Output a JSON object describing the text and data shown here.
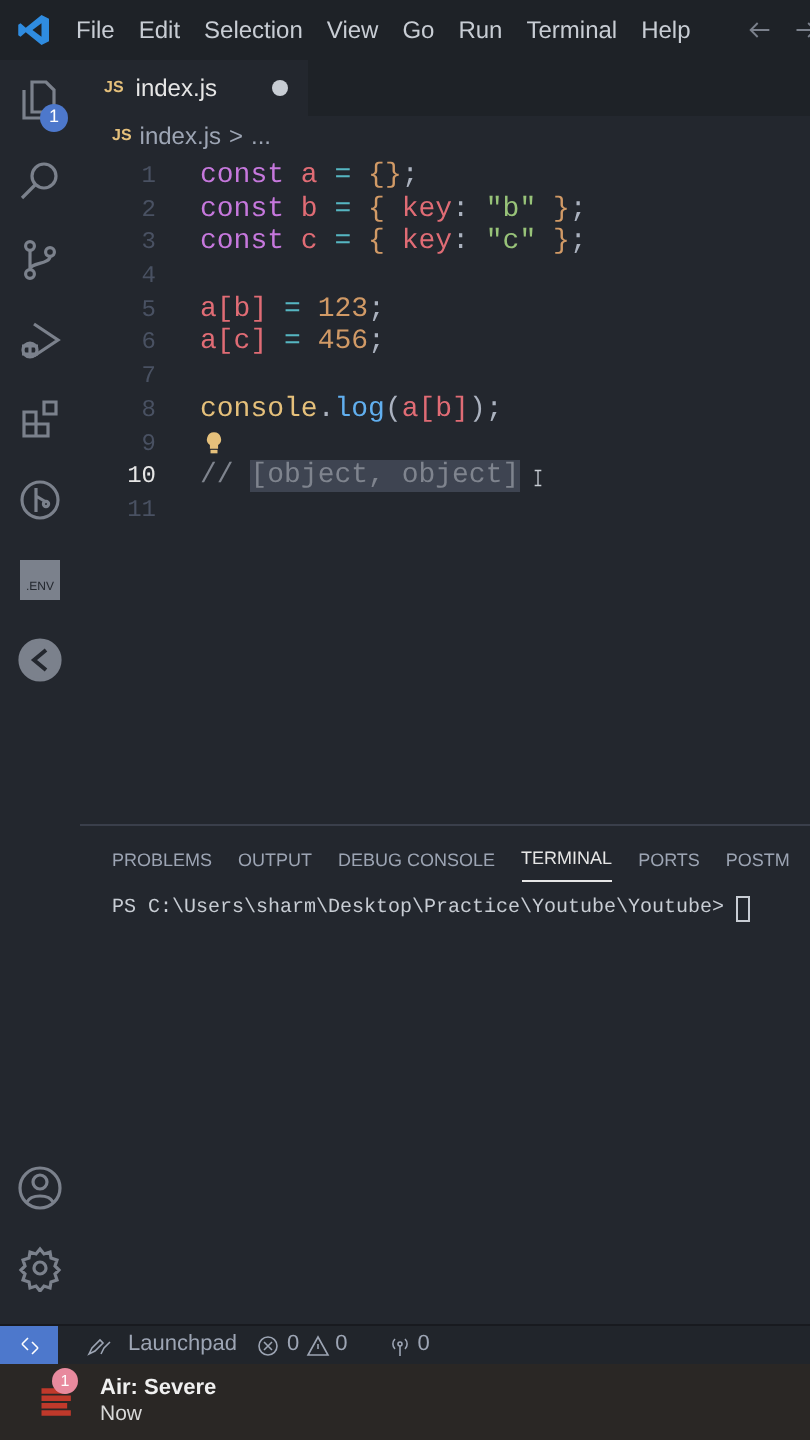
{
  "menu": [
    "File",
    "Edit",
    "Selection",
    "View",
    "Go",
    "Run",
    "Terminal",
    "Help"
  ],
  "activity_bar": {
    "top": [
      {
        "kind": "explorer",
        "badge": "1",
        "selected": false
      },
      {
        "kind": "search",
        "selected": false
      },
      {
        "kind": "source-control",
        "selected": false
      },
      {
        "kind": "run-debug",
        "selected": false
      },
      {
        "kind": "extensions",
        "selected": false
      },
      {
        "kind": "git-graph",
        "selected": false
      },
      {
        "kind": "env",
        "label": ".ENV",
        "selected": false
      },
      {
        "kind": "remote",
        "selected": false
      }
    ],
    "bottom": [
      {
        "kind": "account"
      },
      {
        "kind": "settings"
      }
    ]
  },
  "tabs": [
    {
      "badge": "JS",
      "label": "index.js",
      "modified": true,
      "selected": true
    }
  ],
  "breadcrumb": {
    "badge": "JS",
    "file": "index.js",
    "separator": ">",
    "rest": "..."
  },
  "editor": {
    "lines": [
      {
        "number": "1",
        "active": false,
        "lightbulb": false,
        "tokens": [
          {
            "text": "const",
            "kind": "keyword"
          },
          {
            "text": " a ",
            "kind": "var"
          },
          {
            "text": "=",
            "kind": "op"
          },
          {
            "text": " {}",
            "kind": "brace"
          },
          {
            "text": ";",
            "kind": "punct"
          }
        ]
      },
      {
        "number": "2",
        "active": false,
        "lightbulb": false,
        "tokens": [
          {
            "text": "const",
            "kind": "keyword"
          },
          {
            "text": " b ",
            "kind": "var"
          },
          {
            "text": "=",
            "kind": "op"
          },
          {
            "text": " { ",
            "kind": "brace"
          },
          {
            "text": "key",
            "kind": "prop"
          },
          {
            "text": ": ",
            "kind": "punct"
          },
          {
            "text": "\"b\"",
            "kind": "string"
          },
          {
            "text": " }",
            "kind": "brace"
          },
          {
            "text": ";",
            "kind": "punct"
          }
        ]
      },
      {
        "number": "3",
        "active": false,
        "lightbulb": false,
        "tokens": [
          {
            "text": "const",
            "kind": "keyword"
          },
          {
            "text": " c ",
            "kind": "var"
          },
          {
            "text": "=",
            "kind": "op"
          },
          {
            "text": " { ",
            "kind": "brace"
          },
          {
            "text": "key",
            "kind": "prop"
          },
          {
            "text": ": ",
            "kind": "punct"
          },
          {
            "text": "\"c\"",
            "kind": "string"
          },
          {
            "text": " }",
            "kind": "brace"
          },
          {
            "text": ";",
            "kind": "punct"
          }
        ]
      },
      {
        "number": "4",
        "active": false,
        "lightbulb": false
      },
      {
        "number": "5",
        "active": false,
        "lightbulb": false,
        "tokens": [
          {
            "text": "a[b]",
            "kind": "var"
          },
          {
            "text": " = ",
            "kind": "op"
          },
          {
            "text": "123",
            "kind": "number"
          },
          {
            "text": ";",
            "kind": "punct"
          }
        ]
      },
      {
        "number": "6",
        "active": false,
        "lightbulb": false,
        "tokens": [
          {
            "text": "a[c]",
            "kind": "var"
          },
          {
            "text": " = ",
            "kind": "op"
          },
          {
            "text": "456",
            "kind": "number"
          },
          {
            "text": ";",
            "kind": "punct"
          }
        ]
      },
      {
        "number": "7",
        "active": false,
        "lightbulb": false
      },
      {
        "number": "8",
        "active": false,
        "lightbulb": false,
        "tokens": [
          {
            "text": "console",
            "kind": "object"
          },
          {
            "text": ".",
            "kind": "punct"
          },
          {
            "text": "log",
            "kind": "function"
          },
          {
            "text": "(",
            "kind": "punct"
          },
          {
            "text": "a[b]",
            "kind": "var"
          },
          {
            "text": ");",
            "kind": "punct"
          }
        ]
      },
      {
        "number": "9",
        "active": false,
        "lightbulb": true
      },
      {
        "number": "10",
        "active": true,
        "lightbulb": false,
        "tokens": [
          {
            "text": "// ",
            "kind": "comment"
          },
          {
            "text": "[object, object]",
            "kind": "selected"
          }
        ]
      },
      {
        "number": "11",
        "active": false,
        "lightbulb": false
      }
    ]
  },
  "panel": {
    "tabs": [
      {
        "label": "PROBLEMS",
        "selected": false
      },
      {
        "label": "OUTPUT",
        "selected": false
      },
      {
        "label": "DEBUG CONSOLE",
        "selected": false
      },
      {
        "label": "TERMINAL",
        "selected": true
      },
      {
        "label": "PORTS",
        "selected": false
      },
      {
        "label": "POSTM",
        "selected": false
      }
    ],
    "terminal_prompt": "PS C:\\Users\\sharm\\Desktop\\Practice\\Youtube\\Youtube>"
  },
  "status_bar": {
    "launchpad": "Launchpad",
    "errors": "0",
    "warnings": "0",
    "ports": "0"
  },
  "notification": {
    "badge": "1",
    "title": "Air: Severe",
    "time": "Now"
  }
}
